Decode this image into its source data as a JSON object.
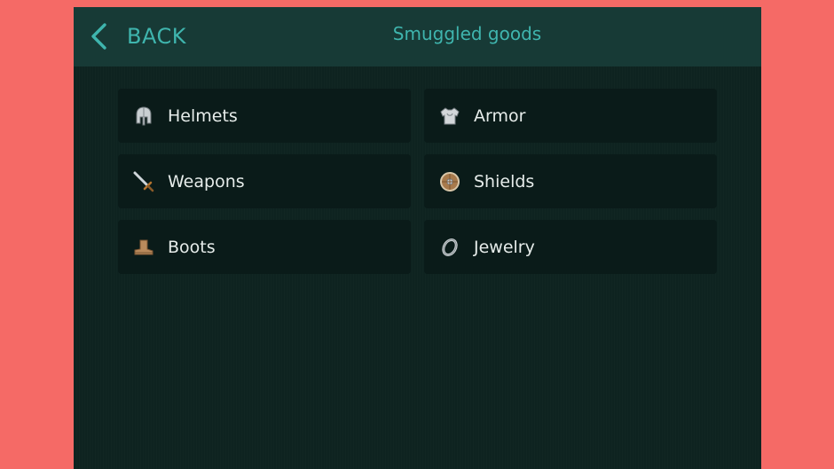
{
  "header": {
    "back_label": "BACK",
    "title": "Smuggled goods"
  },
  "categories": [
    {
      "label": "Helmets",
      "icon": "helmet-icon"
    },
    {
      "label": "Armor",
      "icon": "armor-icon"
    },
    {
      "label": "Weapons",
      "icon": "sword-icon"
    },
    {
      "label": "Shields",
      "icon": "shield-icon"
    },
    {
      "label": "Boots",
      "icon": "boot-icon"
    },
    {
      "label": "Jewelry",
      "icon": "ring-icon"
    }
  ],
  "colors": {
    "background": "#f56a66",
    "panel": "#0e2320",
    "header": "#173a36",
    "accent": "#3fb5ae",
    "tile": "#0a1b19",
    "text": "#e6ecea"
  }
}
